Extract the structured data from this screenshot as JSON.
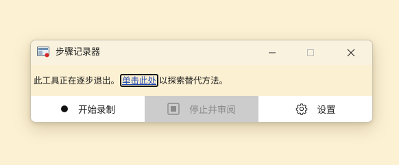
{
  "window": {
    "title": "步骤记录器",
    "icon": "steps-recorder-icon"
  },
  "caption_buttons": {
    "minimize": "minimize-icon",
    "maximize": "maximize-icon",
    "close": "close-icon"
  },
  "notice": {
    "prefix": "此工具正在逐步退出。",
    "link": "单击此处",
    "suffix": "以探索替代方法。"
  },
  "toolbar": {
    "start_label": "开始录制",
    "stop_label": "停止并审阅",
    "settings_label": "设置"
  },
  "colors": {
    "background": "#fcf1d3",
    "link": "#1d47b3",
    "disabled_button": "#cccccc",
    "disabled_text": "#8a8a8a"
  }
}
